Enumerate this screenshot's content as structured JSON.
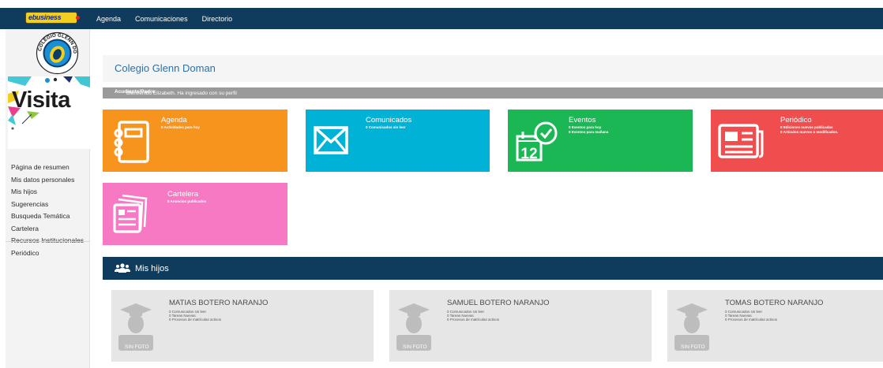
{
  "topbar": {
    "logo_text": "ebusiness",
    "nav": [
      "Agenda",
      "Comunicaciones",
      "Directorio"
    ]
  },
  "sidebar": {
    "crest_text": "COLEGIO GLENN DOMAN",
    "banner_text": "Visita",
    "menu": [
      "Página de resumen",
      "Mis datos personales",
      "Mis hijos",
      "Sugerencias",
      "Busqueda Temática",
      "Cartelera",
      "Recursos Institucionales",
      "Periódico"
    ]
  },
  "main": {
    "title": "Colegio Glenn Doman",
    "welcome_prefix": "Bienvenido Elizabeth. Ha ingresado con su perfil ",
    "welcome_profile": "Acudiente/Padre",
    "welcome_suffix": "."
  },
  "tiles": [
    {
      "title": "Agenda",
      "lines": [
        "0 Actividades para hoy"
      ],
      "color": "#f7941d",
      "icon": "notebook-icon"
    },
    {
      "title": "Comunicados",
      "lines": [
        "0 Comunicados sin leer"
      ],
      "color": "#00b3d6",
      "icon": "envelope-icon"
    },
    {
      "title": "Eventos",
      "lines": [
        "0 Eventos para hoy",
        "0 Eventos para mañana"
      ],
      "color": "#1cb755",
      "icon": "calendar-clock-icon"
    },
    {
      "title": "Periódico",
      "lines": [
        "0 Ediciones nuevas publicadas",
        "0 Artículos nuevos o modificados."
      ],
      "color": "#f04e4e",
      "icon": "newspaper-icon"
    },
    {
      "title": "Cartelera",
      "lines": [
        "0 Anuncios publicados"
      ],
      "color": "#f779c4",
      "icon": "billboard-icon"
    }
  ],
  "kids_section": {
    "title": "Mis hijos",
    "no_photo": "SIN FOTO",
    "children": [
      {
        "name": "MATIAS BOTERO NARANJO",
        "stats": [
          "0 Comunicados sin leer",
          "0 Tareas Nuevas",
          "0 Procesos de matrículas activos"
        ]
      },
      {
        "name": "SAMUEL BOTERO NARANJO",
        "stats": [
          "0 Comunicados sin leer",
          "0 Tareas Nuevas",
          "0 Procesos de matrículas activos"
        ]
      },
      {
        "name": "TOMAS BOTERO NARANJO",
        "stats": [
          "0 Comunicados sin leer",
          "0 Tareas Nuevas",
          "0 Procesos de matrículas activos"
        ]
      }
    ]
  }
}
